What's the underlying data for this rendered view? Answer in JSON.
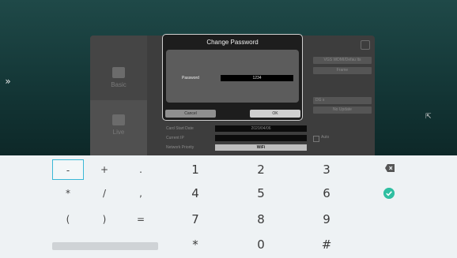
{
  "background_app": {
    "sidebar": {
      "items": [
        {
          "label": "Basic",
          "icon": "settings-icon"
        },
        {
          "label": "Live",
          "icon": "display-icon"
        }
      ]
    },
    "right_chips": [
      "VGS WDMI/Defau lts",
      "Frame",
      "DG s",
      "No Update"
    ],
    "form": {
      "rows": [
        {
          "label": "Card Start Date",
          "value": "2020/04/06"
        },
        {
          "label": "Current IP",
          "value": ""
        },
        {
          "label": "Network Priority",
          "value": "WiFi"
        }
      ],
      "auto_label": "Auto"
    }
  },
  "dialog": {
    "title": "Change Password",
    "password_label": "Password",
    "password_value": "1234",
    "cancel_label": "Cancel",
    "ok_label": "OK"
  },
  "keyboard": {
    "rows": [
      [
        "-",
        "+",
        ".",
        "1",
        "2",
        "3"
      ],
      [
        "*",
        "/",
        ",",
        "4",
        "5",
        "6"
      ],
      [
        "(",
        ")",
        "=",
        "7",
        "8",
        "9"
      ],
      [
        "",
        "",
        "",
        "*",
        "0",
        "#"
      ]
    ],
    "accent_color": "#3ab8d6",
    "confirm_color": "#2fbfa1"
  }
}
